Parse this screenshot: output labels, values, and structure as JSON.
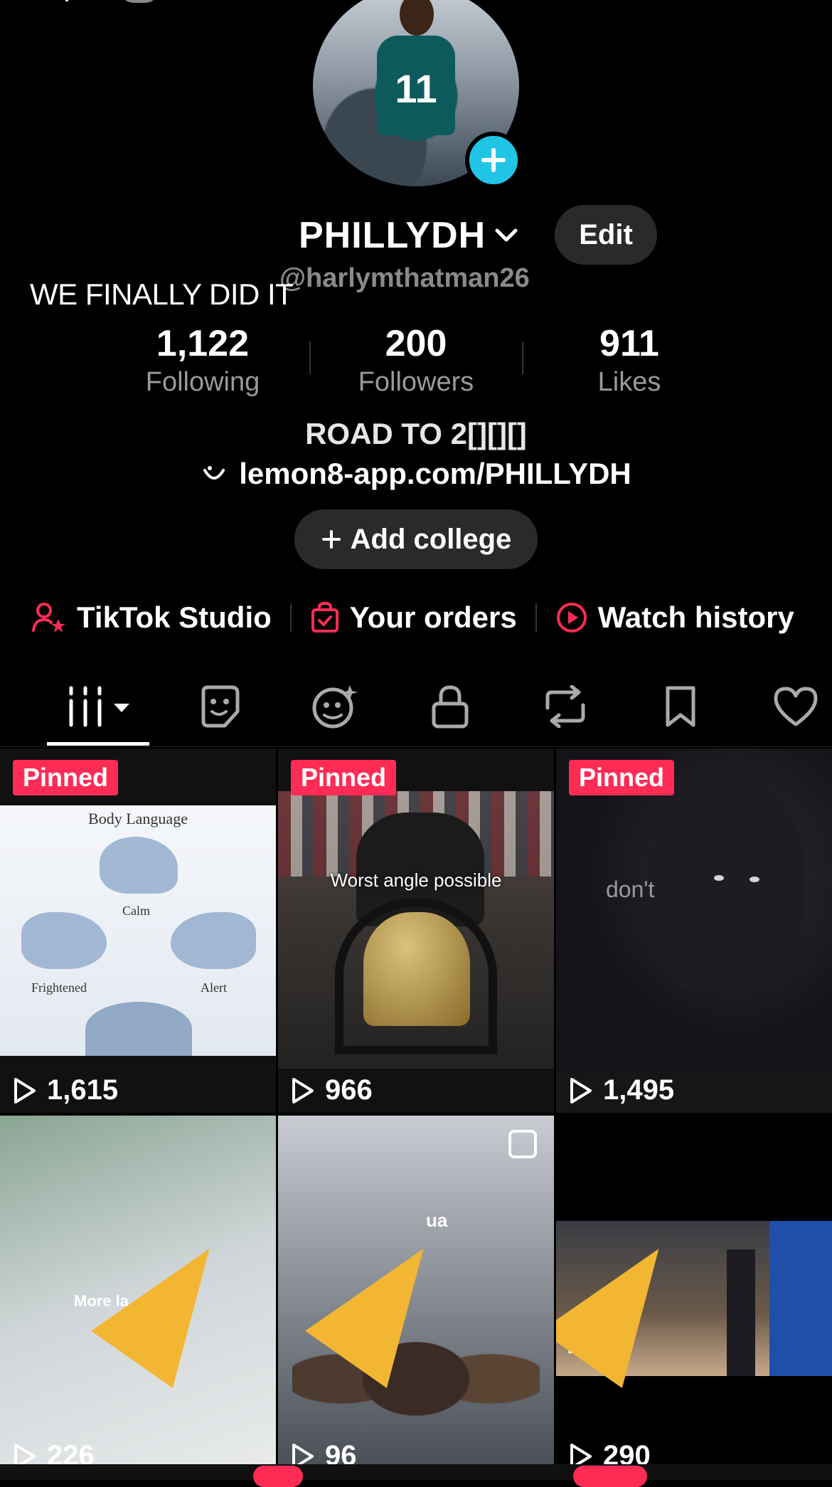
{
  "profile": {
    "display_name": "PHILLYDH",
    "handle": "@harlymthatman26",
    "edit_label": "Edit",
    "overlay_text": "WE FINALLY DID IT",
    "bio": "ROAD TO 2[][][]",
    "link": "lemon8-app.com/PHILLYDH",
    "add_college_label": "Add college",
    "jersey_number": "11"
  },
  "stats": {
    "following": {
      "value": "1,122",
      "label": "Following"
    },
    "followers": {
      "value": "200",
      "label": "Followers"
    },
    "likes": {
      "value": "911",
      "label": "Likes"
    }
  },
  "quick_links": [
    {
      "label": "TikTok Studio",
      "icon": "user-star-icon"
    },
    {
      "label": "Your orders",
      "icon": "shopping-bag-icon"
    },
    {
      "label": "Watch history",
      "icon": "play-circle-icon"
    }
  ],
  "tabs": [
    {
      "icon": "grid-icon",
      "selected": true
    },
    {
      "icon": "sticker-icon"
    },
    {
      "icon": "ai-face-icon"
    },
    {
      "icon": "lock-icon"
    },
    {
      "icon": "repost-icon"
    },
    {
      "icon": "bookmark-icon"
    },
    {
      "icon": "heart-icon"
    }
  ],
  "videos": [
    {
      "pinned": "Pinned",
      "views": "1,615",
      "caption": "Body Language",
      "labels": [
        "Calm",
        "Frightened",
        "Alert"
      ]
    },
    {
      "pinned": "Pinned",
      "views": "966",
      "caption": "Worst angle possible"
    },
    {
      "pinned": "Pinned",
      "views": "1,495",
      "caption": "don't"
    },
    {
      "views": "226",
      "caption": "More la"
    },
    {
      "views": "96",
      "caption": "ua"
    },
    {
      "views": "290",
      "caption": "BROOK"
    }
  ],
  "colors": {
    "accent": "#fe2c55",
    "plus_badge": "#20c5e6",
    "button_bg": "#2a2a2a"
  }
}
